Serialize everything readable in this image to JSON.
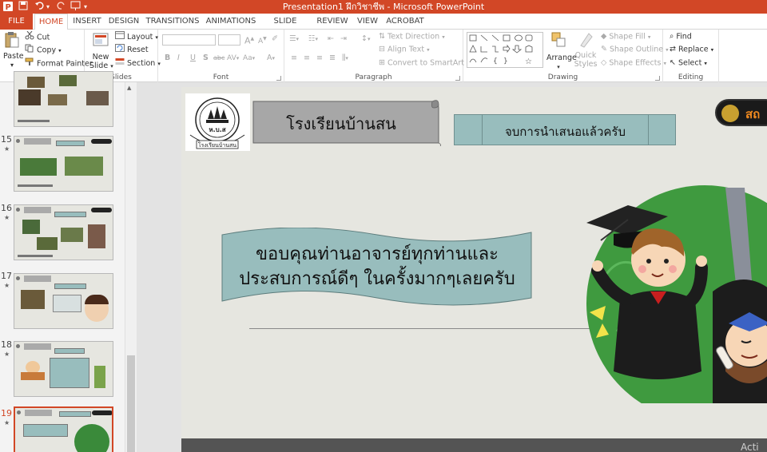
{
  "window": {
    "title": "Presentation1 ฝึกวิชาชีพ -  Microsoft PowerPoint"
  },
  "tabs": [
    "FILE",
    "HOME",
    "INSERT",
    "DESIGN",
    "TRANSITIONS",
    "ANIMATIONS",
    "SLIDE SHOW",
    "REVIEW",
    "VIEW",
    "ACROBAT"
  ],
  "active_tab": "HOME",
  "ribbon": {
    "clipboard": {
      "paste": "Paste",
      "cut": "Cut",
      "copy": "Copy",
      "format_painter": "Format Painter",
      "label": "Clipboard"
    },
    "slides": {
      "new_slide": "New",
      "new_slide2": "Slide",
      "layout": "Layout",
      "reset": "Reset",
      "section": "Section",
      "label": "Slides"
    },
    "font": {
      "label": "Font",
      "bold": "B",
      "italic": "I",
      "underline": "U",
      "strike": "S",
      "shadow": "abc",
      "spacing": "AV",
      "case": "Aa",
      "color": "A"
    },
    "paragraph": {
      "label": "Paragraph",
      "text_direction": "Text Direction",
      "align_text": "Align Text",
      "convert_smartart": "Convert to SmartArt"
    },
    "drawing": {
      "label": "Drawing",
      "arrange": "Arrange",
      "quick_styles": "Quick Styles",
      "shape_fill": "Shape Fill",
      "shape_outline": "Shape Outline",
      "shape_effects": "Shape Effects"
    },
    "editing": {
      "label": "Editing",
      "find": "Find",
      "replace": "Replace",
      "select": "Select"
    }
  },
  "thumbnails": [
    {
      "number": "",
      "star": ""
    },
    {
      "number": "15",
      "star": "★"
    },
    {
      "number": "16",
      "star": "★"
    },
    {
      "number": "17",
      "star": "★"
    },
    {
      "number": "18",
      "star": "★"
    },
    {
      "number": "19",
      "star": "★",
      "selected": true
    }
  ],
  "slide": {
    "school_name": "โรงเรียนบ้านสน",
    "header_box": "จบการนำเสนอแล้วครับ",
    "thanks_line1": "ขอบคุณท่านอาจารย์ทุกท่านและ",
    "thanks_line2": "ประสบการณ์ดีๆ ในครั้งมากๆเลยครับ",
    "logo_text_top": "ห.บ.ส",
    "logo_text_bottom": "โรงเรียนบ้านสน",
    "badge_text": "สถ",
    "watermark": "Acti"
  },
  "colors": {
    "accent": "#d24726",
    "slide_bg": "#e6e6e0",
    "banner_fill": "#98bdbd",
    "scroll_fill": "#a7a7a7"
  }
}
